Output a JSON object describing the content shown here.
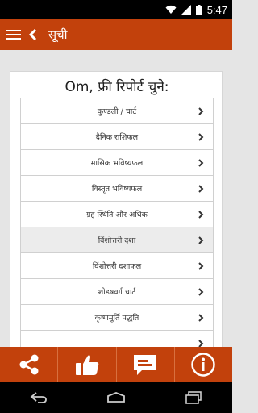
{
  "status": {
    "time": "5:47"
  },
  "appbar": {
    "title": "सूची"
  },
  "card": {
    "title": "Om, फ्री रिपोर्ट चुने:",
    "items": [
      {
        "label": "कुण्डली / चार्ट"
      },
      {
        "label": "दैनिक राशिफल"
      },
      {
        "label": "मासिक भविष्यफल"
      },
      {
        "label": "विस्तृत भविष्यफल"
      },
      {
        "label": "ग्रह स्थिति और अधिक"
      },
      {
        "label": "विंशोत्तरी दशा"
      },
      {
        "label": "विंशोत्तरी दशाफल"
      },
      {
        "label": "शोडषवर्ग चार्ट"
      },
      {
        "label": "कृष्णमूर्ति पद्धति"
      },
      {
        "label": ""
      }
    ]
  },
  "colors": {
    "accent": "#c2410c",
    "background": "#e5e5e5"
  },
  "bottombar": {
    "icons": [
      "share-icon",
      "thumbs-up-icon",
      "message-icon",
      "info-icon"
    ]
  }
}
